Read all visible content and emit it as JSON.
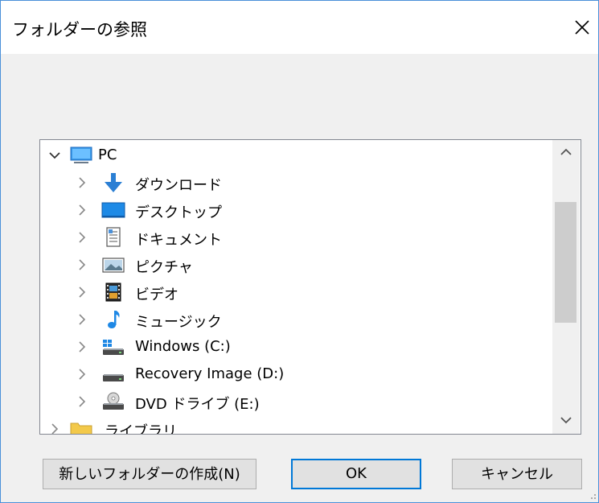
{
  "dialog": {
    "title": "フォルダーの参照",
    "close_icon": "close-icon"
  },
  "tree": {
    "root": {
      "label": "PC",
      "icon": "pc-icon",
      "expanded": true
    },
    "items": [
      {
        "label": "ダウンロード",
        "icon": "download-arrow-icon"
      },
      {
        "label": "デスクトップ",
        "icon": "desktop-icon"
      },
      {
        "label": "ドキュメント",
        "icon": "document-icon"
      },
      {
        "label": "ピクチャ",
        "icon": "picture-icon"
      },
      {
        "label": "ビデオ",
        "icon": "video-icon"
      },
      {
        "label": "ミュージック",
        "icon": "music-note-icon"
      },
      {
        "label": "Windows (C:)",
        "icon": "windows-drive-icon"
      },
      {
        "label": "Recovery Image (D:)",
        "icon": "drive-icon"
      },
      {
        "label": "DVD ドライブ (E:)",
        "icon": "dvd-drive-icon"
      }
    ],
    "partial_item": {
      "label": "ライブラリ",
      "icon": "folder-icon"
    }
  },
  "buttons": {
    "new_folder": "新しいフォルダーの作成(N)",
    "ok": "OK",
    "cancel": "キャンセル"
  },
  "colors": {
    "accent": "#0078d7",
    "border": "#4a90d9"
  }
}
